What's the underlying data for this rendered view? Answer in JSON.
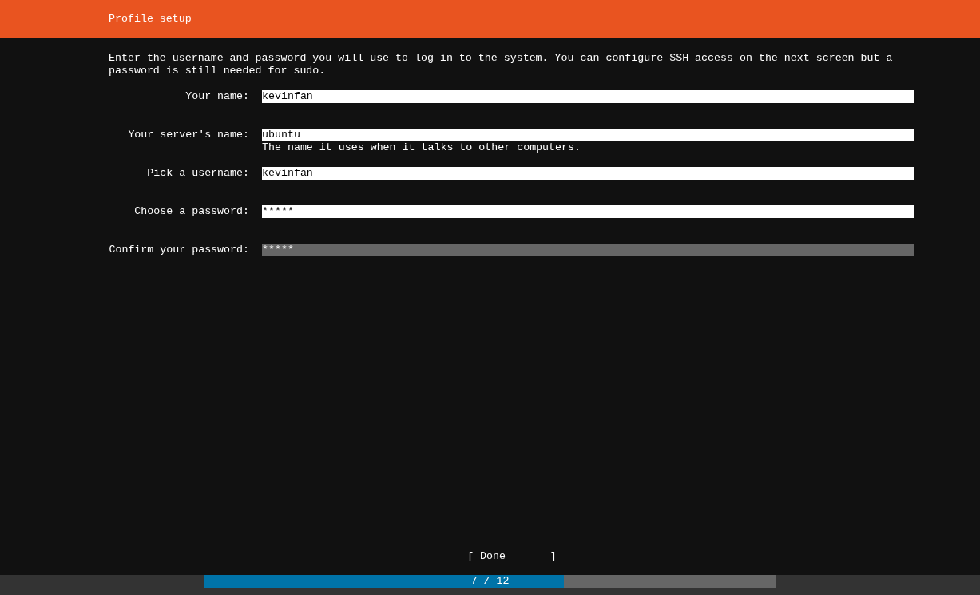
{
  "header": {
    "title": "Profile setup"
  },
  "intro": "Enter the username and password you will use to log in to the system. You can configure SSH access on the next screen but a password is still needed for sudo.",
  "fields": [
    {
      "label": "Your name:",
      "value": "kevinfan",
      "focused": false
    },
    {
      "label": "Your server's name:",
      "value": "ubuntu",
      "caption": "The name it uses when it talks to other computers.",
      "focused": false
    },
    {
      "label": "Pick a username:",
      "value": "kevinfan",
      "focused": false
    },
    {
      "label": "Choose a password:",
      "value": "*****",
      "focused": false
    },
    {
      "label": "Confirm your password:",
      "value": "*****",
      "focused": true
    }
  ],
  "done_button": "[ Done       ]",
  "progress": {
    "text": "7 / 12",
    "level": 0.63
  }
}
